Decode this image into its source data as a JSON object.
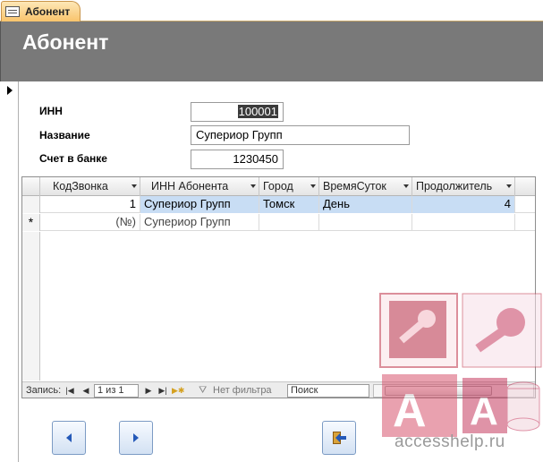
{
  "tab": {
    "label": "Абонент",
    "icon": "form-icon"
  },
  "form": {
    "title": "Абонент"
  },
  "fields": {
    "inn": {
      "label": "ИНН",
      "value": "100001"
    },
    "name": {
      "label": "Название",
      "value": "Супериор Групп"
    },
    "account": {
      "label": "Счет в банке",
      "value": "1230450"
    }
  },
  "subform": {
    "columns": [
      "КодЗвонка",
      "ИНН Абонента",
      "Город",
      "ВремяСуток",
      "Продолжитель"
    ],
    "rows": [
      {
        "id": "1",
        "inn": "Супериор Групп",
        "city": "Томск",
        "time": "День",
        "duration": "4"
      },
      {
        "marker": "*",
        "id": "(№)",
        "inn": "Супериор Групп",
        "city": "",
        "time": "",
        "duration": ""
      }
    ],
    "nav": {
      "record_label": "Запись:",
      "position": "1 из 1",
      "filter_label": "Нет фильтра",
      "search_placeholder": "Поиск"
    }
  },
  "buttons": {
    "prev_icon": "arrow-left-icon",
    "next_icon": "arrow-right-icon",
    "exit_icon": "exit-door-icon"
  },
  "watermark": {
    "text": "accesshelp.ru"
  },
  "colors": {
    "header_bg": "#797979",
    "tab_bg": "#f9c46c",
    "row_highlight": "#c8ddf4",
    "button_accent": "#2459b8"
  }
}
